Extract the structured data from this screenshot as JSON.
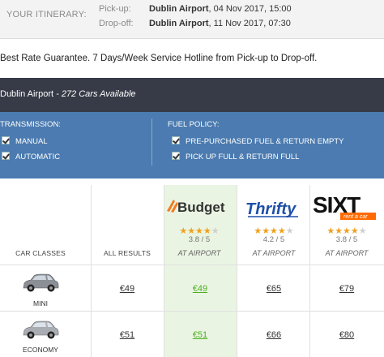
{
  "itinerary": {
    "title": "YOUR ITINERARY:",
    "pickup": {
      "label": "Pick-up:",
      "location": "Dublin Airport",
      "datetime": ", 04 Nov 2017, 15:00"
    },
    "dropoff": {
      "label": "Drop-off:",
      "location": "Dublin Airport",
      "datetime": ", 11 Nov 2017, 07:30"
    }
  },
  "guarantee": "Best Rate Guarantee. 7 Days/Week Service Hotline from Pick-up to Drop-off.",
  "location_bar": {
    "location": "Dublin Airport",
    "available": " - 272 Cars Available"
  },
  "filters": {
    "transmission": {
      "title": "TRANSMISSION:",
      "options": [
        "MANUAL",
        "AUTOMATIC"
      ]
    },
    "fuel_policy": {
      "title": "FUEL POLICY:",
      "options": [
        "PRE-PURCHASED FUEL & RETURN EMPTY",
        "PICK UP FULL & RETURN FULL"
      ]
    }
  },
  "columns": {
    "car_classes": "CAR CLASSES",
    "all_results": "ALL RESULTS"
  },
  "suppliers": [
    {
      "logo_text": "Budget",
      "stars": 3.8,
      "rating": "3.8 / 5",
      "location": "AT AIRPORT"
    },
    {
      "logo_text": "Thrifty",
      "stars": 4.2,
      "rating": "4.2 / 5",
      "location": "AT AIRPORT"
    },
    {
      "logo_text": "SIXT",
      "logo_sub": "rent a car",
      "stars": 3.8,
      "rating": "3.8 / 5",
      "location": "AT AIRPORT"
    }
  ],
  "rows": [
    {
      "class": "MINI",
      "car_color": "#8b8f96",
      "all": "€49",
      "prices": [
        "€49",
        "€65",
        "€79"
      ]
    },
    {
      "class": "ECONOMY",
      "car_color": "#a9adb3",
      "all": "€51",
      "prices": [
        "€51",
        "€66",
        "€80"
      ]
    }
  ],
  "colors": {
    "best_price": "#4caf1f",
    "star": "#f0a11e",
    "filter_bg": "#4b7bb0",
    "location_bar_bg": "#363b47"
  }
}
